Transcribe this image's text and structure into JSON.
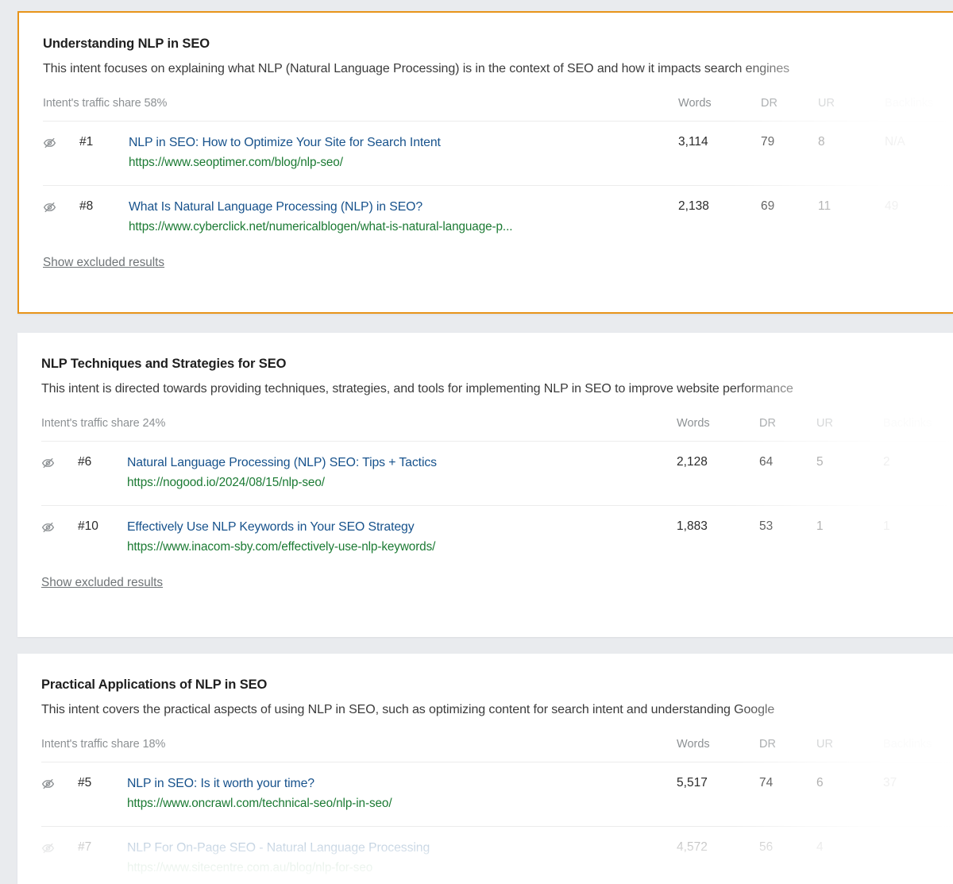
{
  "table": {
    "columns": [
      "Words",
      "DR",
      "UR",
      "Backlinks"
    ],
    "show_excluded_label": "Show excluded results",
    "share_prefix": "Intent's traffic share"
  },
  "colors": {
    "selected_border": "#e8941a",
    "link": "#17528c",
    "url": "#1b7a33",
    "muted": "#8d9194",
    "page_background": "#e9ebee",
    "card_background": "#ffffff"
  },
  "icons": {
    "hide_result": "eye-slash-icon"
  },
  "cards": [
    {
      "selected": true,
      "title": "Understanding NLP in SEO",
      "description": "This intent focuses on explaining what NLP (Natural Language Processing) is in the context of SEO and how it impacts search engines",
      "share": "Intent's traffic share 58%",
      "columns": {
        "words": "Words",
        "dr": "DR",
        "ur": "UR",
        "backlinks": "Backlinks"
      },
      "show_excluded": "Show excluded results",
      "rows": [
        {
          "position": "#1",
          "title": "NLP in SEO: How to Optimize Your Site for Search Intent",
          "url": "https://www.seoptimer.com/blog/nlp-seo/",
          "words": "3,114",
          "dr": "79",
          "ur": "8",
          "backlinks": "N/A"
        },
        {
          "position": "#8",
          "title": "What Is Natural Language Processing (NLP) in SEO?",
          "url": "https://www.cyberclick.net/numericalblogen/what-is-natural-language-p...",
          "words": "2,138",
          "dr": "69",
          "ur": "11",
          "backlinks": "49"
        }
      ]
    },
    {
      "selected": false,
      "title": "NLP Techniques and Strategies for SEO",
      "description": "This intent is directed towards providing techniques, strategies, and tools for implementing NLP in SEO to improve website performance",
      "share": "Intent's traffic share 24%",
      "columns": {
        "words": "Words",
        "dr": "DR",
        "ur": "UR",
        "backlinks": "Backlinks"
      },
      "show_excluded": "Show excluded results",
      "rows": [
        {
          "position": "#6",
          "title": "Natural Language Processing (NLP) SEO: Tips + Tactics",
          "url": "https://nogood.io/2024/08/15/nlp-seo/",
          "words": "2,128",
          "dr": "64",
          "ur": "5",
          "backlinks": "2"
        },
        {
          "position": "#10",
          "title": "Effectively Use NLP Keywords in Your SEO Strategy",
          "url": "https://www.inacom-sby.com/effectively-use-nlp-keywords/",
          "words": "1,883",
          "dr": "53",
          "ur": "1",
          "backlinks": "1"
        }
      ]
    },
    {
      "selected": false,
      "title": "Practical Applications of NLP in SEO",
      "description": "This intent covers the practical aspects of using NLP in SEO, such as optimizing content for search intent and understanding Google",
      "share": "Intent's traffic share 18%",
      "columns": {
        "words": "Words",
        "dr": "DR",
        "ur": "UR",
        "backlinks": "Backlinks"
      },
      "show_excluded": "Show excluded results",
      "rows": [
        {
          "position": "#5",
          "title": "NLP in SEO: Is it worth your time?",
          "url": "https://www.oncrawl.com/technical-seo/nlp-in-seo/",
          "words": "5,517",
          "dr": "74",
          "ur": "6",
          "backlinks": "37"
        },
        {
          "position": "#7",
          "title": "NLP For On-Page SEO - Natural Language Processing",
          "url": "https://www.sitecentre.com.au/blog/nlp-for-seo",
          "words": "4,572",
          "dr": "56",
          "ur": "4",
          "backlinks": ""
        }
      ]
    }
  ]
}
